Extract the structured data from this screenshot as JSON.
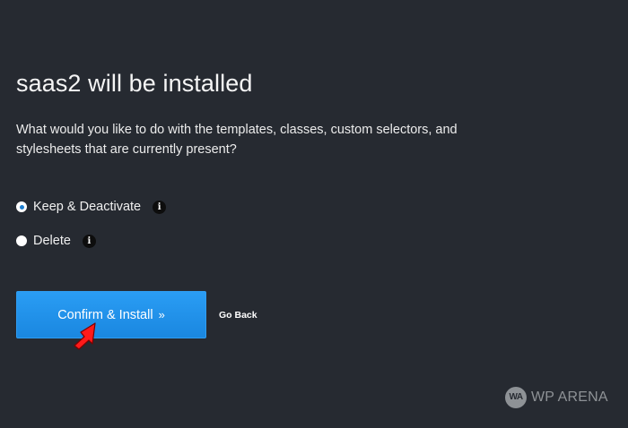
{
  "page": {
    "title": "saas2 will be installed",
    "question": "What would you like to do with the templates, classes, custom selectors, and stylesheets that are currently present?"
  },
  "options": [
    {
      "label": "Keep & Deactivate",
      "selected": true
    },
    {
      "label": "Delete",
      "selected": false
    }
  ],
  "actions": {
    "confirm_label": "Confirm & Install",
    "confirm_chevron": "»",
    "go_back_label": "Go Back"
  },
  "icons": {
    "info_glyph": "i",
    "info_icon": "info-icon",
    "annotation": "red-arrow-pointer"
  },
  "watermark": {
    "logo_text": "WA",
    "text": "WP ARENA"
  },
  "colors": {
    "background": "#262a31",
    "accent": "#1a87e0",
    "annotation": "#ff1a1a",
    "watermark": "#8e9296"
  }
}
